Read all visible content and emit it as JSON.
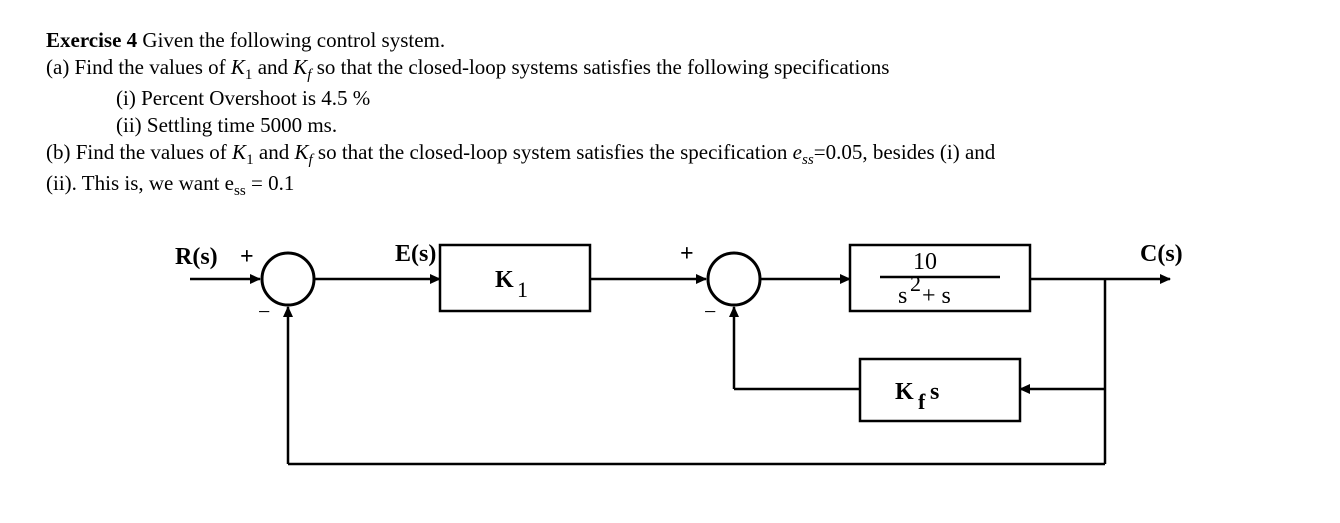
{
  "problem": {
    "title_prefix": "Exercise 4",
    "title_rest": " Given the following control system.",
    "part_a_lead": "(a) Find the values of ",
    "K1_sym_K": "K",
    "K1_sub": "1",
    "and_word": " and ",
    "Kf_sym_K": "K",
    "Kf_sub": "f",
    "part_a_tail": " so that the closed-loop systems satisfies the following specifications",
    "spec_i": "(i) Percent Overshoot is 4.5 %",
    "spec_ii": "(ii) Settling time 5000 ms.",
    "part_b_lead": "(b) Find the values of ",
    "part_b_mid": " so that  the closed-loop system  satisfies the specification ",
    "ess_sym_e": "e",
    "ess_sub": "ss",
    "ess_eq": "=0.05, besides  (i) and",
    "part_b_line2": "(ii). This is, we want e",
    "part_b_line2_sub": "ss",
    "part_b_line2_tail": " = 0.1"
  },
  "diagram": {
    "signal_R": "R(s)",
    "signal_E": "E(s)",
    "signal_C": "C(s)",
    "block_K1_K": "K",
    "block_K1_sub": "1",
    "plant_num": "10",
    "plant_den_left": "s",
    "plant_den_exp": "2",
    "plant_den_rest": " + s",
    "block_Kf_K": "K",
    "block_Kf_sub": "f",
    "block_Kf_tail": " s",
    "plus": "+",
    "minus": "−"
  }
}
